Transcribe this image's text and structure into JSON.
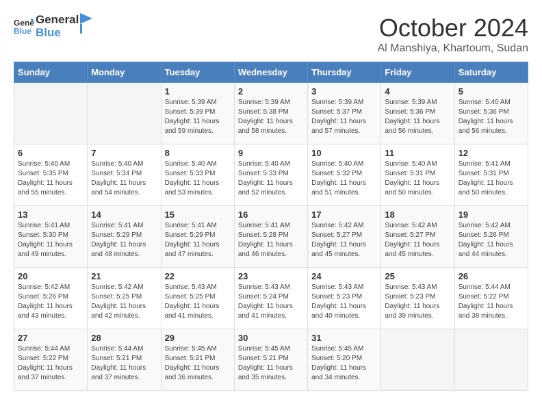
{
  "header": {
    "logo": {
      "general": "General",
      "blue": "Blue"
    },
    "month": "October 2024",
    "location": "Al Manshiya, Khartoum, Sudan"
  },
  "weekdays": [
    "Sunday",
    "Monday",
    "Tuesday",
    "Wednesday",
    "Thursday",
    "Friday",
    "Saturday"
  ],
  "weeks": [
    [
      {
        "day": "",
        "sunrise": "",
        "sunset": "",
        "daylight": ""
      },
      {
        "day": "",
        "sunrise": "",
        "sunset": "",
        "daylight": ""
      },
      {
        "day": "1",
        "sunrise": "Sunrise: 5:39 AM",
        "sunset": "Sunset: 5:39 PM",
        "daylight": "Daylight: 11 hours and 59 minutes."
      },
      {
        "day": "2",
        "sunrise": "Sunrise: 5:39 AM",
        "sunset": "Sunset: 5:38 PM",
        "daylight": "Daylight: 11 hours and 58 minutes."
      },
      {
        "day": "3",
        "sunrise": "Sunrise: 5:39 AM",
        "sunset": "Sunset: 5:37 PM",
        "daylight": "Daylight: 11 hours and 57 minutes."
      },
      {
        "day": "4",
        "sunrise": "Sunrise: 5:39 AM",
        "sunset": "Sunset: 5:36 PM",
        "daylight": "Daylight: 11 hours and 56 minutes."
      },
      {
        "day": "5",
        "sunrise": "Sunrise: 5:40 AM",
        "sunset": "Sunset: 5:36 PM",
        "daylight": "Daylight: 11 hours and 56 minutes."
      }
    ],
    [
      {
        "day": "6",
        "sunrise": "Sunrise: 5:40 AM",
        "sunset": "Sunset: 5:35 PM",
        "daylight": "Daylight: 11 hours and 55 minutes."
      },
      {
        "day": "7",
        "sunrise": "Sunrise: 5:40 AM",
        "sunset": "Sunset: 5:34 PM",
        "daylight": "Daylight: 11 hours and 54 minutes."
      },
      {
        "day": "8",
        "sunrise": "Sunrise: 5:40 AM",
        "sunset": "Sunset: 5:33 PM",
        "daylight": "Daylight: 11 hours and 53 minutes."
      },
      {
        "day": "9",
        "sunrise": "Sunrise: 5:40 AM",
        "sunset": "Sunset: 5:33 PM",
        "daylight": "Daylight: 11 hours and 52 minutes."
      },
      {
        "day": "10",
        "sunrise": "Sunrise: 5:40 AM",
        "sunset": "Sunset: 5:32 PM",
        "daylight": "Daylight: 11 hours and 51 minutes."
      },
      {
        "day": "11",
        "sunrise": "Sunrise: 5:40 AM",
        "sunset": "Sunset: 5:31 PM",
        "daylight": "Daylight: 11 hours and 50 minutes."
      },
      {
        "day": "12",
        "sunrise": "Sunrise: 5:41 AM",
        "sunset": "Sunset: 5:31 PM",
        "daylight": "Daylight: 11 hours and 50 minutes."
      }
    ],
    [
      {
        "day": "13",
        "sunrise": "Sunrise: 5:41 AM",
        "sunset": "Sunset: 5:30 PM",
        "daylight": "Daylight: 11 hours and 49 minutes."
      },
      {
        "day": "14",
        "sunrise": "Sunrise: 5:41 AM",
        "sunset": "Sunset: 5:29 PM",
        "daylight": "Daylight: 11 hours and 48 minutes."
      },
      {
        "day": "15",
        "sunrise": "Sunrise: 5:41 AM",
        "sunset": "Sunset: 5:29 PM",
        "daylight": "Daylight: 11 hours and 47 minutes."
      },
      {
        "day": "16",
        "sunrise": "Sunrise: 5:41 AM",
        "sunset": "Sunset: 5:28 PM",
        "daylight": "Daylight: 11 hours and 46 minutes."
      },
      {
        "day": "17",
        "sunrise": "Sunrise: 5:42 AM",
        "sunset": "Sunset: 5:27 PM",
        "daylight": "Daylight: 11 hours and 45 minutes."
      },
      {
        "day": "18",
        "sunrise": "Sunrise: 5:42 AM",
        "sunset": "Sunset: 5:27 PM",
        "daylight": "Daylight: 11 hours and 45 minutes."
      },
      {
        "day": "19",
        "sunrise": "Sunrise: 5:42 AM",
        "sunset": "Sunset: 5:26 PM",
        "daylight": "Daylight: 11 hours and 44 minutes."
      }
    ],
    [
      {
        "day": "20",
        "sunrise": "Sunrise: 5:42 AM",
        "sunset": "Sunset: 5:26 PM",
        "daylight": "Daylight: 11 hours and 43 minutes."
      },
      {
        "day": "21",
        "sunrise": "Sunrise: 5:42 AM",
        "sunset": "Sunset: 5:25 PM",
        "daylight": "Daylight: 11 hours and 42 minutes."
      },
      {
        "day": "22",
        "sunrise": "Sunrise: 5:43 AM",
        "sunset": "Sunset: 5:25 PM",
        "daylight": "Daylight: 11 hours and 41 minutes."
      },
      {
        "day": "23",
        "sunrise": "Sunrise: 5:43 AM",
        "sunset": "Sunset: 5:24 PM",
        "daylight": "Daylight: 11 hours and 41 minutes."
      },
      {
        "day": "24",
        "sunrise": "Sunrise: 5:43 AM",
        "sunset": "Sunset: 5:23 PM",
        "daylight": "Daylight: 11 hours and 40 minutes."
      },
      {
        "day": "25",
        "sunrise": "Sunrise: 5:43 AM",
        "sunset": "Sunset: 5:23 PM",
        "daylight": "Daylight: 11 hours and 39 minutes."
      },
      {
        "day": "26",
        "sunrise": "Sunrise: 5:44 AM",
        "sunset": "Sunset: 5:22 PM",
        "daylight": "Daylight: 11 hours and 38 minutes."
      }
    ],
    [
      {
        "day": "27",
        "sunrise": "Sunrise: 5:44 AM",
        "sunset": "Sunset: 5:22 PM",
        "daylight": "Daylight: 11 hours and 37 minutes."
      },
      {
        "day": "28",
        "sunrise": "Sunrise: 5:44 AM",
        "sunset": "Sunset: 5:21 PM",
        "daylight": "Daylight: 11 hours and 37 minutes."
      },
      {
        "day": "29",
        "sunrise": "Sunrise: 5:45 AM",
        "sunset": "Sunset: 5:21 PM",
        "daylight": "Daylight: 11 hours and 36 minutes."
      },
      {
        "day": "30",
        "sunrise": "Sunrise: 5:45 AM",
        "sunset": "Sunset: 5:21 PM",
        "daylight": "Daylight: 11 hours and 35 minutes."
      },
      {
        "day": "31",
        "sunrise": "Sunrise: 5:45 AM",
        "sunset": "Sunset: 5:20 PM",
        "daylight": "Daylight: 11 hours and 34 minutes."
      },
      {
        "day": "",
        "sunrise": "",
        "sunset": "",
        "daylight": ""
      },
      {
        "day": "",
        "sunrise": "",
        "sunset": "",
        "daylight": ""
      }
    ]
  ]
}
